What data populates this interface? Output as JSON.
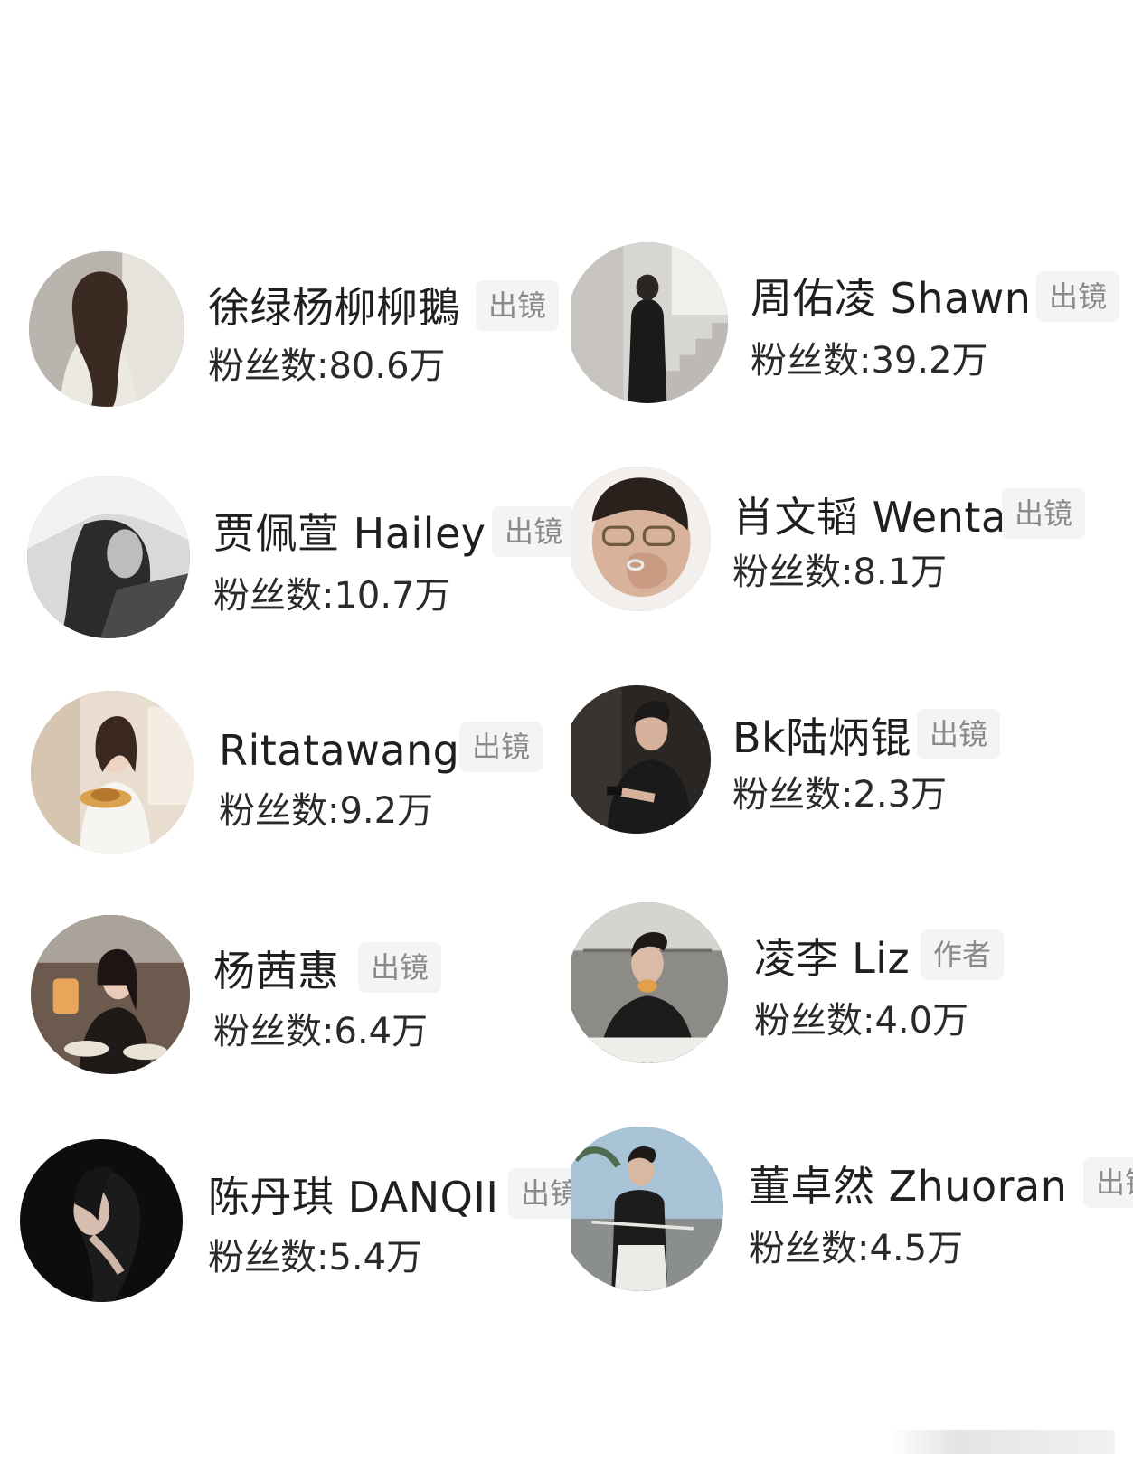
{
  "fans_prefix": "粉丝数:",
  "left_column": [
    {
      "name": "徐绿杨柳柳鵝",
      "badge": "出镜",
      "fans": "粉丝数:80.6万",
      "avatar_icon": "woman-portrait-icon"
    },
    {
      "name": "贾佩萱 Hailey",
      "badge": "出镜",
      "fans": "粉丝数:10.7万",
      "avatar_icon": "woman-bw-portrait-icon"
    },
    {
      "name": "Ritatawang",
      "badge": "出镜",
      "fans": "粉丝数:9.2万",
      "avatar_icon": "woman-cake-portrait-icon"
    },
    {
      "name": "杨茜惠",
      "badge": "出镜",
      "fans": "粉丝数:6.4万",
      "avatar_icon": "woman-dinner-portrait-icon"
    },
    {
      "name": "陈丹琪 DANQII",
      "badge": "出镜",
      "fans": "粉丝数:5.4万",
      "avatar_icon": "woman-dark-portrait-icon"
    }
  ],
  "right_column": [
    {
      "name": "周佑凌 Shawn",
      "badge": "出镜",
      "fans": "粉丝数:39.2万",
      "avatar_icon": "man-stairs-portrait-icon"
    },
    {
      "name": "肖文韬 Wentao",
      "badge": "出镜",
      "fans": "粉丝数:8.1万",
      "avatar_icon": "man-glasses-portrait-icon"
    },
    {
      "name": "Bk陆炳锟",
      "badge": "出镜",
      "fans": "粉丝数:2.3万",
      "avatar_icon": "man-phone-portrait-icon"
    },
    {
      "name": "凌李 Liz",
      "badge": "作者",
      "fans": "粉丝数:4.0万",
      "avatar_icon": "man-restaurant-portrait-icon"
    },
    {
      "name": "董卓然 Zhuoran",
      "badge": "出镜",
      "fans": "粉丝数:4.5万",
      "avatar_icon": "man-beach-portrait-icon"
    }
  ],
  "colors": {
    "badge_bg": "#f4f4f4",
    "badge_text": "#8a8a8a",
    "name_text": "#1f1f1f"
  }
}
